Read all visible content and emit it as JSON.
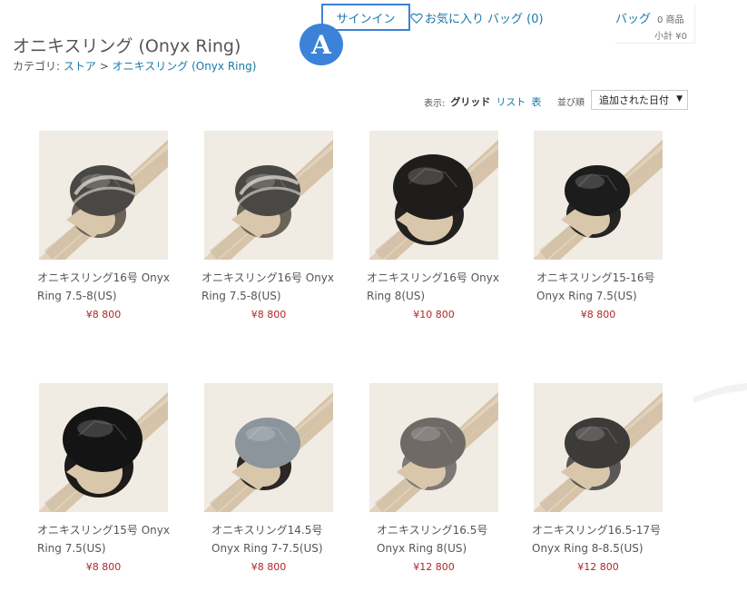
{
  "header": {
    "signin_label": "サインイン",
    "favorites_label": "お気に入り",
    "bag_link_label": "バッグ (0)",
    "cart": {
      "bag_label": "バッグ",
      "item_count": "0 商品",
      "subtotal": "小計 ¥0"
    }
  },
  "annotation": {
    "badge_label": "A",
    "color": "#3b82d8"
  },
  "page": {
    "title": "オニキスリング (Onyx Ring)",
    "breadcrumb_prefix": "カテゴリ:",
    "breadcrumb_store": "ストア",
    "breadcrumb_sep": ">",
    "breadcrumb_current": "オニキスリング (Onyx Ring)"
  },
  "view_controls": {
    "label": "表示:",
    "grid": "グリッド",
    "list": "リスト",
    "table": "表",
    "sort_label": "並び順",
    "sort_selected": "追加された日付"
  },
  "products": [
    {
      "name": "オニキスリング16号 Onyx Ring 7.5-8(US)",
      "price": "¥8 800"
    },
    {
      "name": "オニキスリング16号 Onyx Ring 7.5-8(US)",
      "price": "¥8 800"
    },
    {
      "name": "オニキスリング16号 Onyx Ring 8(US)",
      "price": "¥10 800"
    },
    {
      "name": "オニキスリング15-16号 Onyx Ring 7.5(US)",
      "price": "¥8 800"
    },
    {
      "name": "オニキスリング15号 Onyx Ring 7.5(US)",
      "price": "¥8 800"
    },
    {
      "name": "オニキスリング14.5号 Onyx Ring 7-7.5(US)",
      "price": "¥8 800"
    },
    {
      "name": "オニキスリング16.5号 Onyx Ring 8(US)",
      "price": "¥12 800"
    },
    {
      "name": "オニキスリング16.5-17号 Onyx Ring 8-8.5(US)",
      "price": "¥12 800"
    }
  ],
  "colors": {
    "link": "#1a78a8",
    "price": "#b0262b",
    "text": "#555555"
  }
}
